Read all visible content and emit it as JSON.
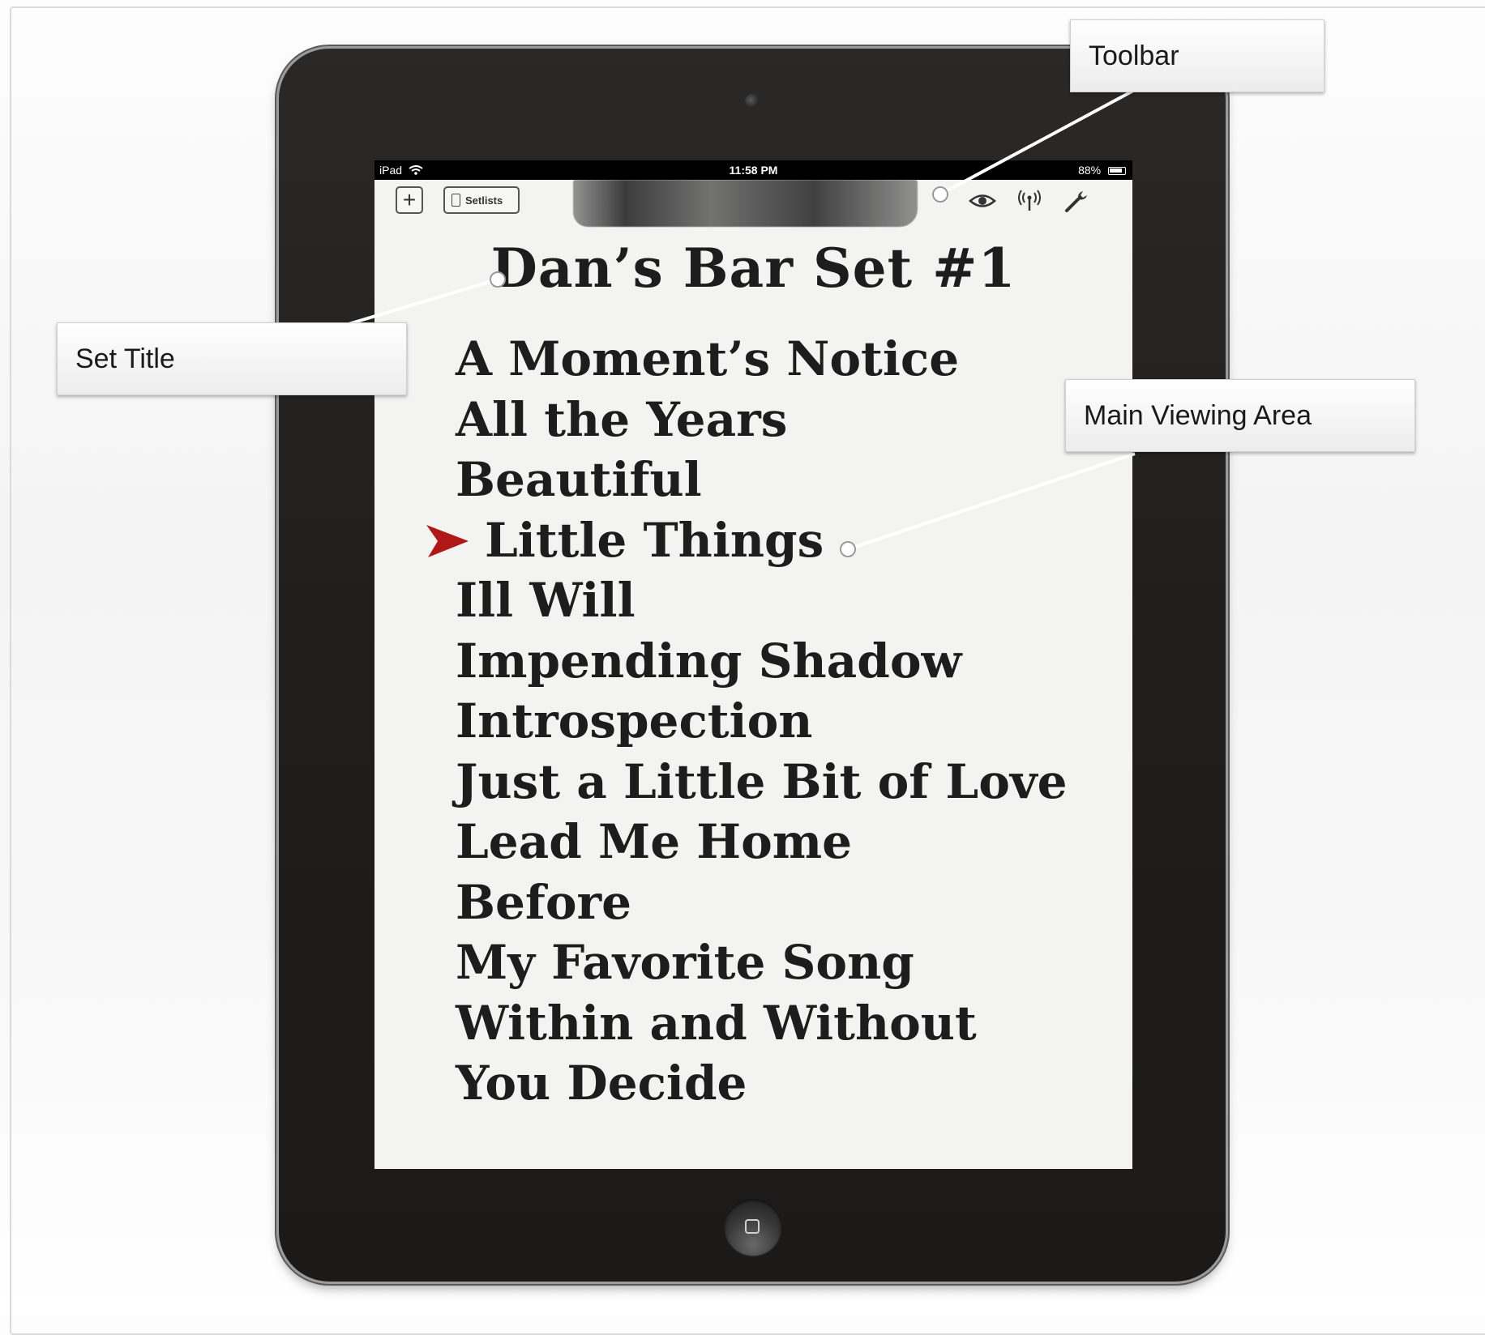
{
  "status_bar": {
    "carrier": "iPad",
    "time": "11:58 PM",
    "battery": "88%"
  },
  "toolbar": {
    "setlists_label": "Setlists"
  },
  "setlist": {
    "title": "Dan’s Bar Set #1",
    "songs": [
      "A Moment’s Notice",
      "All the Years",
      "Beautiful",
      "Little Things",
      "Ill Will",
      "Impending Shadow",
      "Introspection",
      "Just a Little Bit of Love",
      "Lead Me Home",
      "Before",
      "My Favorite Song",
      "Within and Without",
      "You Decide"
    ],
    "current_song": "Little Things"
  },
  "callouts": {
    "toolbar": "Toolbar",
    "set_title": "Set Title",
    "main_viewing_area": "Main Viewing Area"
  },
  "colors": {
    "bezel": "#201e1c",
    "paper": "#f3f3f1",
    "ink": "#1d1d1d",
    "marker": "#b01818"
  },
  "icons": [
    "plus-icon",
    "document-icon",
    "eye-icon",
    "broadcast-icon",
    "wrench-icon",
    "wifi-icon",
    "battery-icon",
    "play-marker-icon"
  ]
}
